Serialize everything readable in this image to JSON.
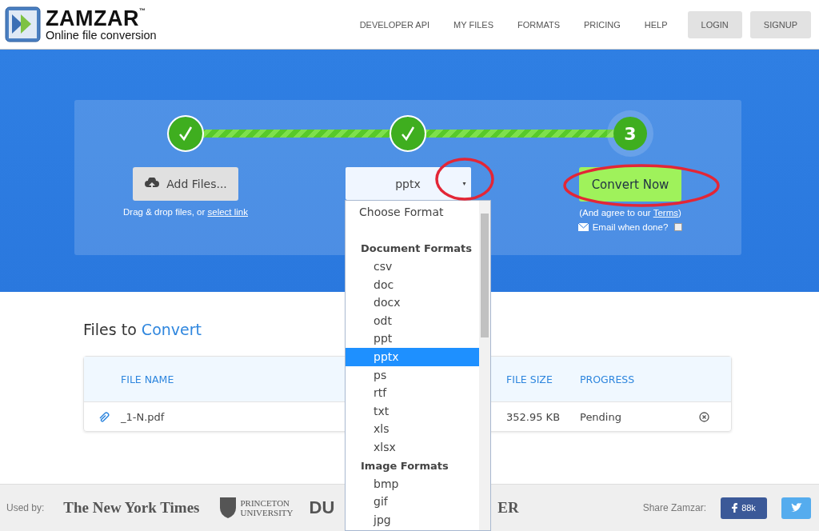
{
  "brand": {
    "name": "ZAMZAR",
    "trademark": "™",
    "tagline": "Online file conversion"
  },
  "nav": {
    "links": [
      "DEVELOPER API",
      "MY FILES",
      "FORMATS",
      "PRICING",
      "HELP"
    ],
    "buttons": [
      "LOGIN",
      "SIGNUP"
    ]
  },
  "steps": [
    {
      "done": true
    },
    {
      "done": true
    },
    {
      "done": false,
      "label": "3"
    }
  ],
  "add_files": {
    "label": "Add Files...",
    "hint": "Drag & drop files, or",
    "link": "select link"
  },
  "format_select": {
    "value": "pptx",
    "caret": "▾"
  },
  "format_menu": {
    "prompt": "Choose Format",
    "groups": [
      {
        "title": "Document Formats",
        "items": [
          {
            "label": "csv",
            "selected": false
          },
          {
            "label": "doc",
            "selected": false
          },
          {
            "label": "docx",
            "selected": false
          },
          {
            "label": "odt",
            "selected": false
          },
          {
            "label": "ppt",
            "selected": false
          },
          {
            "label": "pptx",
            "selected": true
          },
          {
            "label": "ps",
            "selected": false
          },
          {
            "label": "rtf",
            "selected": false
          },
          {
            "label": "txt",
            "selected": false
          },
          {
            "label": "xls",
            "selected": false
          },
          {
            "label": "xlsx",
            "selected": false
          }
        ]
      },
      {
        "title": "Image Formats",
        "items": [
          {
            "label": "bmp",
            "selected": false
          },
          {
            "label": "gif",
            "selected": false
          },
          {
            "label": "jpg",
            "selected": false
          }
        ]
      }
    ]
  },
  "convert": {
    "label": "Convert Now",
    "agree": "(And agree to our",
    "terms": "Terms",
    "agree_end": ")",
    "email_label": "Email when done?",
    "email_checked": false
  },
  "files": {
    "title_plain": "Files to",
    "title_accent": "Convert",
    "columns": [
      "FILE NAME",
      "FILE SIZE",
      "PROGRESS"
    ],
    "rows": [
      {
        "name": "_1-N.pdf",
        "size": "352.95 KB",
        "progress": "Pending"
      }
    ]
  },
  "footer": {
    "used_by": "Used by:",
    "logos": [
      {
        "kind": "serif",
        "text": "The New York Times"
      },
      {
        "kind": "crest",
        "lines": [
          "PRINCETON",
          "UNIVERSITY"
        ]
      },
      {
        "kind": "bold",
        "text": "DU"
      },
      {
        "kind": "serif",
        "text": "ER"
      }
    ],
    "share_label": "Share Zamzar:",
    "facebook_count": "88k"
  }
}
